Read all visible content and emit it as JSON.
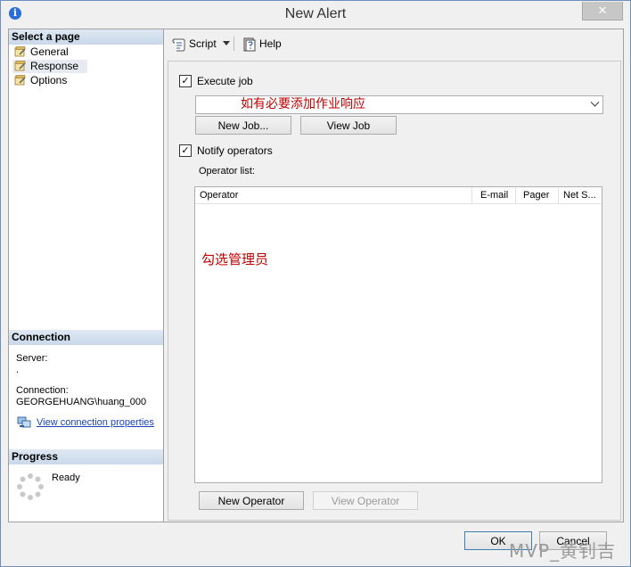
{
  "window": {
    "title": "New Alert",
    "close_glyph": "✕"
  },
  "left": {
    "select_page_header": "Select a page",
    "pages": [
      {
        "label": "General",
        "icon": "wrench-page-icon"
      },
      {
        "label": "Response",
        "icon": "wrench-page-icon",
        "selected": true
      },
      {
        "label": "Options",
        "icon": "wrench-page-icon"
      }
    ],
    "connection_header": "Connection",
    "server_label": "Server:",
    "server_value": ".",
    "connection_label": "Connection:",
    "connection_value": "GEORGEHUANG\\huang_000",
    "view_connection_link": "View connection properties",
    "progress_header": "Progress",
    "progress_status": "Ready"
  },
  "toolbar": {
    "script_label": "Script",
    "help_label": "Help"
  },
  "response": {
    "execute_job_label": "Execute job",
    "execute_job_checked": true,
    "job_combo_value": "如有必要添加作业响应",
    "new_job_button": "New Job...",
    "view_job_button": "View Job",
    "notify_operators_label": "Notify operators",
    "notify_operators_checked": true,
    "operator_list_label": "Operator list:",
    "columns": [
      "Operator",
      "E-mail",
      "Pager",
      "Net S..."
    ],
    "grid_annotation": "勾选管理员",
    "new_operator_button": "New Operator",
    "view_operator_button": "View Operator"
  },
  "footer": {
    "ok_button": "OK",
    "cancel_button": "Cancel"
  },
  "watermark": "MVP_黄钊吉",
  "colors": {
    "annotation_red": "#c00000",
    "link_blue": "#1a44b8",
    "section_header": "#c9d8ea"
  }
}
